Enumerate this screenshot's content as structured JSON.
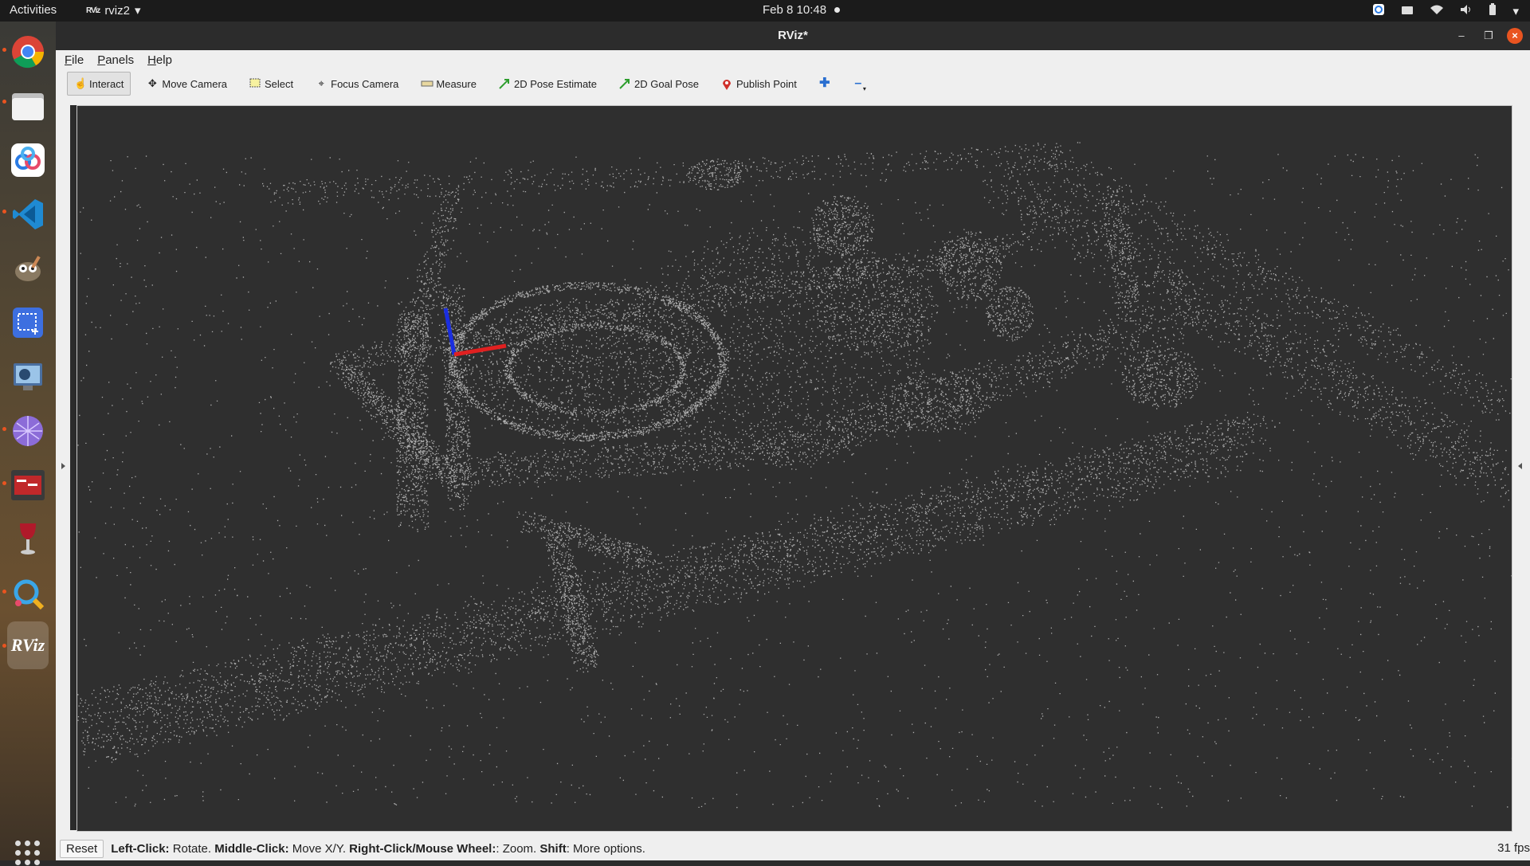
{
  "topbar": {
    "activities": "Activities",
    "app_name": "rviz2",
    "clock": "Feb 8  10:48"
  },
  "dock": {
    "items": [
      {
        "name": "chrome-icon",
        "running": true
      },
      {
        "name": "files-icon",
        "running": true
      },
      {
        "name": "baidu-netdisk-icon",
        "running": false
      },
      {
        "name": "vscode-icon",
        "running": true
      },
      {
        "name": "gimp-icon",
        "running": false
      },
      {
        "name": "screenshot-icon",
        "running": false
      },
      {
        "name": "system-monitor-icon",
        "running": false
      },
      {
        "name": "network-icon",
        "running": true
      },
      {
        "name": "terminal-icon",
        "running": true
      },
      {
        "name": "wine-icon",
        "running": false
      },
      {
        "name": "search-app-icon",
        "running": true
      },
      {
        "name": "rviz-icon",
        "running": true
      }
    ],
    "rviz_label": "RViz"
  },
  "window": {
    "title": "RViz*"
  },
  "menu": {
    "file_first": "F",
    "file_rest": "ile",
    "panels_first": "P",
    "panels_rest": "anels",
    "help_first": "H",
    "help_rest": "elp"
  },
  "toolbar": {
    "interact": "Interact",
    "move_camera": "Move Camera",
    "select": "Select",
    "focus_camera": "Focus Camera",
    "measure": "Measure",
    "pose_estimate": "2D Pose Estimate",
    "goal_pose": "2D Goal Pose",
    "publish_point": "Publish Point",
    "accent_pose_color": "#2e9e2e",
    "accent_point_color": "#d0302a"
  },
  "status": {
    "reset": "Reset",
    "left_click_label": "Left-Click:",
    "left_click_text": " Rotate. ",
    "middle_click_label": "Middle-Click:",
    "middle_click_text": " Move X/Y. ",
    "right_click_label": "Right-Click/Mouse Wheel:",
    "right_click_text": ": Zoom. ",
    "shift_label": "Shift",
    "shift_text": ": More options.",
    "fps": "31 fps"
  },
  "viewport": {
    "background": "#2f2f2f",
    "point_color": "#e0e0e0",
    "axis_x_color": "#e02020",
    "axis_z_color": "#1a2ee0"
  }
}
